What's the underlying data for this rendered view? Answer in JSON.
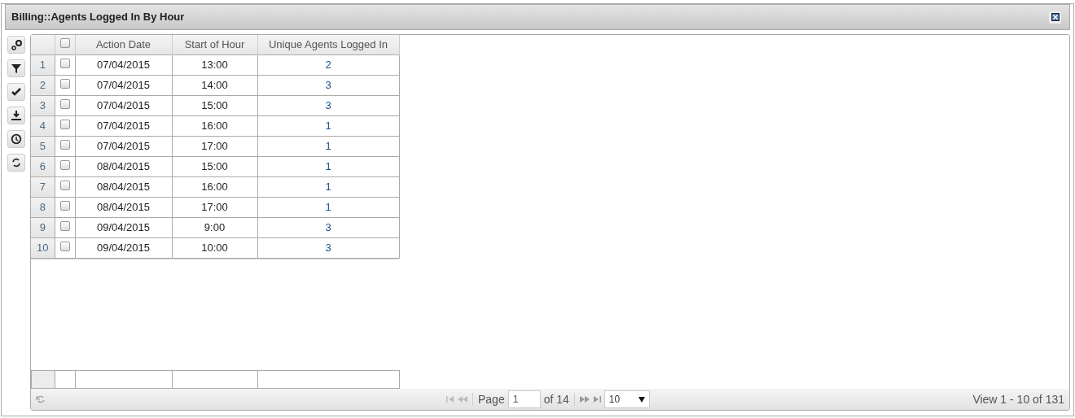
{
  "window": {
    "title": "Billing::Agents Logged In By Hour"
  },
  "toolbar": [
    {
      "kind": "columns"
    },
    {
      "kind": "filter"
    },
    {
      "kind": "check"
    },
    {
      "kind": "download"
    },
    {
      "kind": "clock"
    },
    {
      "kind": "refresh"
    }
  ],
  "table": {
    "select_all": {
      "checked": false
    },
    "columns": [
      "Action Date",
      "Start of Hour",
      "Unique Agents Logged In"
    ],
    "rows": [
      {
        "number": "1",
        "checked": false,
        "cells": [
          "07/04/2015",
          "13:00",
          "2"
        ]
      },
      {
        "number": "2",
        "checked": false,
        "cells": [
          "07/04/2015",
          "14:00",
          "3"
        ]
      },
      {
        "number": "3",
        "checked": false,
        "cells": [
          "07/04/2015",
          "15:00",
          "3"
        ]
      },
      {
        "number": "4",
        "checked": false,
        "cells": [
          "07/04/2015",
          "16:00",
          "1"
        ]
      },
      {
        "number": "5",
        "checked": false,
        "cells": [
          "07/04/2015",
          "17:00",
          "1"
        ]
      },
      {
        "number": "6",
        "checked": false,
        "cells": [
          "08/04/2015",
          "15:00",
          "1"
        ]
      },
      {
        "number": "7",
        "checked": false,
        "cells": [
          "08/04/2015",
          "16:00",
          "1"
        ]
      },
      {
        "number": "8",
        "checked": false,
        "cells": [
          "08/04/2015",
          "17:00",
          "1"
        ]
      },
      {
        "number": "9",
        "checked": false,
        "cells": [
          "09/04/2015",
          "9:00",
          "3"
        ]
      },
      {
        "number": "10",
        "checked": false,
        "cells": [
          "09/04/2015",
          "10:00",
          "3"
        ]
      }
    ]
  },
  "pager": {
    "page_label": "Page",
    "page": "1",
    "of_label": "of 14",
    "page_size": "10",
    "view": "View 1 - 10 of 131"
  }
}
